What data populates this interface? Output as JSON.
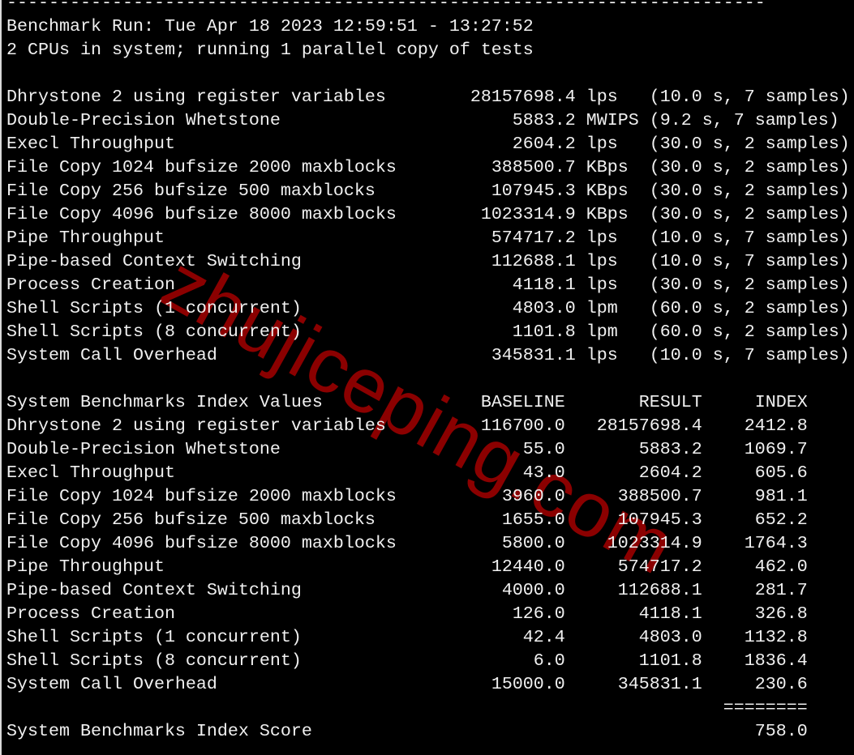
{
  "separator": "------------------------------------------------------------------------",
  "header": {
    "run_line": "Benchmark Run: Tue Apr 18 2023 12:59:51 - 13:27:52",
    "cpu_line": "2 CPUs in system; running 1 parallel copy of tests"
  },
  "raw_results": [
    {
      "test": "Dhrystone 2 using register variables",
      "value": "28157698.4",
      "unit": "lps",
      "detail": "(10.0 s, 7 samples)"
    },
    {
      "test": "Double-Precision Whetstone",
      "value": "5883.2",
      "unit": "MWIPS",
      "detail": "(9.2 s, 7 samples)"
    },
    {
      "test": "Execl Throughput",
      "value": "2604.2",
      "unit": "lps",
      "detail": "(30.0 s, 2 samples)"
    },
    {
      "test": "File Copy 1024 bufsize 2000 maxblocks",
      "value": "388500.7",
      "unit": "KBps",
      "detail": "(30.0 s, 2 samples)"
    },
    {
      "test": "File Copy 256 bufsize 500 maxblocks",
      "value": "107945.3",
      "unit": "KBps",
      "detail": "(30.0 s, 2 samples)"
    },
    {
      "test": "File Copy 4096 bufsize 8000 maxblocks",
      "value": "1023314.9",
      "unit": "KBps",
      "detail": "(30.0 s, 2 samples)"
    },
    {
      "test": "Pipe Throughput",
      "value": "574717.2",
      "unit": "lps",
      "detail": "(10.0 s, 7 samples)"
    },
    {
      "test": "Pipe-based Context Switching",
      "value": "112688.1",
      "unit": "lps",
      "detail": "(10.0 s, 7 samples)"
    },
    {
      "test": "Process Creation",
      "value": "4118.1",
      "unit": "lps",
      "detail": "(30.0 s, 2 samples)"
    },
    {
      "test": "Shell Scripts (1 concurrent)",
      "value": "4803.0",
      "unit": "lpm",
      "detail": "(60.0 s, 2 samples)"
    },
    {
      "test": "Shell Scripts (8 concurrent)",
      "value": "1101.8",
      "unit": "lpm",
      "detail": "(60.0 s, 2 samples)"
    },
    {
      "test": "System Call Overhead",
      "value": "345831.1",
      "unit": "lps",
      "detail": "(10.0 s, 7 samples)"
    }
  ],
  "index_table": {
    "title": "System Benchmarks Index Values",
    "columns": [
      "BASELINE",
      "RESULT",
      "INDEX"
    ],
    "rows": [
      {
        "test": "Dhrystone 2 using register variables",
        "baseline": "116700.0",
        "result": "28157698.4",
        "index": "2412.8"
      },
      {
        "test": "Double-Precision Whetstone",
        "baseline": "55.0",
        "result": "5883.2",
        "index": "1069.7"
      },
      {
        "test": "Execl Throughput",
        "baseline": "43.0",
        "result": "2604.2",
        "index": "605.6"
      },
      {
        "test": "File Copy 1024 bufsize 2000 maxblocks",
        "baseline": "3960.0",
        "result": "388500.7",
        "index": "981.1"
      },
      {
        "test": "File Copy 256 bufsize 500 maxblocks",
        "baseline": "1655.0",
        "result": "107945.3",
        "index": "652.2"
      },
      {
        "test": "File Copy 4096 bufsize 8000 maxblocks",
        "baseline": "5800.0",
        "result": "1023314.9",
        "index": "1764.3"
      },
      {
        "test": "Pipe Throughput",
        "baseline": "12440.0",
        "result": "574717.2",
        "index": "462.0"
      },
      {
        "test": "Pipe-based Context Switching",
        "baseline": "4000.0",
        "result": "112688.1",
        "index": "281.7"
      },
      {
        "test": "Process Creation",
        "baseline": "126.0",
        "result": "4118.1",
        "index": "326.8"
      },
      {
        "test": "Shell Scripts (1 concurrent)",
        "baseline": "42.4",
        "result": "4803.0",
        "index": "1132.8"
      },
      {
        "test": "Shell Scripts (8 concurrent)",
        "baseline": "6.0",
        "result": "1101.8",
        "index": "1836.4"
      },
      {
        "test": "System Call Overhead",
        "baseline": "15000.0",
        "result": "345831.1",
        "index": "230.6"
      }
    ],
    "total_rule": "========",
    "score_label": "System Benchmarks Index Score",
    "score_value": "758.0"
  },
  "watermark": "zhujiceping.com",
  "colors": {
    "background": "#000000",
    "text": "#f0f0f0",
    "watermark": "#8b0000"
  }
}
